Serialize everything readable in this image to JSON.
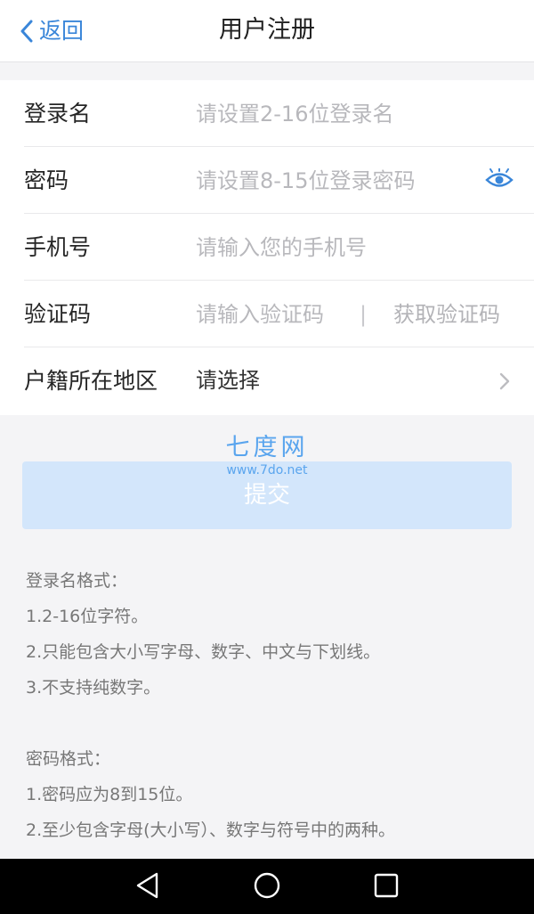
{
  "header": {
    "back_label": "返回",
    "title": "用户注册"
  },
  "form": {
    "login_name": {
      "label": "登录名",
      "placeholder": "请设置2-16位登录名",
      "value": ""
    },
    "password": {
      "label": "密码",
      "placeholder": "请设置8-15位登录密码",
      "value": "",
      "toggle_icon": "eye-icon"
    },
    "phone": {
      "label": "手机号",
      "placeholder": "请输入您的手机号",
      "value": ""
    },
    "code": {
      "label": "验证码",
      "placeholder": "请输入验证码",
      "value": "",
      "separator": "|",
      "send_label": "获取验证码"
    },
    "region": {
      "label": "户籍所在地区",
      "value": "请选择",
      "chevron_icon": "chevron-right-icon"
    }
  },
  "watermark": {
    "title": "七度网",
    "url": "www.7do.net"
  },
  "submit_label": "提交",
  "rules": {
    "login": {
      "title": "登录名格式：",
      "items": [
        "1.2-16位字符。",
        "2.只能包含大小写字母、数字、中文与下划线。",
        "3.不支持纯数字。"
      ]
    },
    "password": {
      "title": "密码格式：",
      "items": [
        "1.密码应为8到15位。",
        "2.至少包含字母(大小写）、数字与符号中的两种。"
      ]
    }
  },
  "colors": {
    "accent": "#3a86d9",
    "submit_bg": "#d3e6fb",
    "placeholder": "#b8b8bc",
    "navbar": "#000000"
  },
  "navbar": {
    "back_icon": "nav-back-icon",
    "home_icon": "nav-home-icon",
    "recents_icon": "nav-recents-icon"
  }
}
